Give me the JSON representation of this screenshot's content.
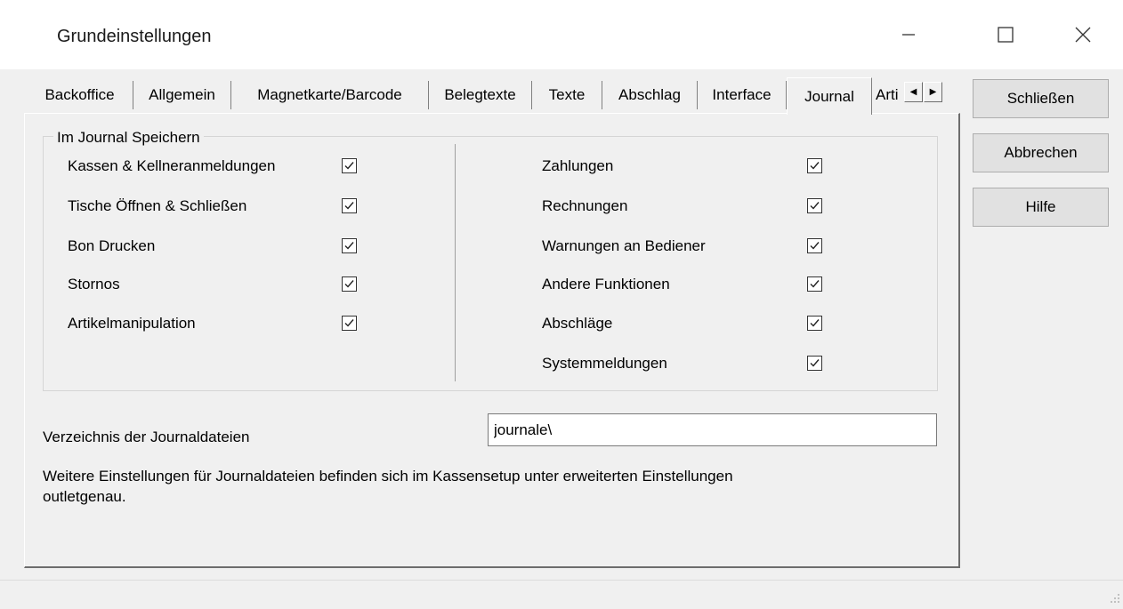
{
  "window": {
    "title": "Grundeinstellungen",
    "minimize_glyph": "—",
    "maximize_glyph": "☐",
    "close_glyph": "✕"
  },
  "tabs": [
    {
      "label": "Backoffice",
      "active": false
    },
    {
      "label": "Allgemein",
      "active": false
    },
    {
      "label": "Magnetkarte/Barcode",
      "active": false
    },
    {
      "label": "Belegtexte",
      "active": false
    },
    {
      "label": "Texte",
      "active": false
    },
    {
      "label": "Abschlag",
      "active": false
    },
    {
      "label": "Interface",
      "active": false
    },
    {
      "label": "Journal",
      "active": true
    },
    {
      "label": "Arti",
      "active": false
    }
  ],
  "tab_scroll": {
    "left_icon": "arrow-left-icon",
    "right_icon": "arrow-right-icon"
  },
  "group": {
    "title": "Im Journal Speichern",
    "left": [
      {
        "label": "Kassen & Kellneranmeldungen",
        "checked": true
      },
      {
        "label": "Tische Öffnen & Schließen",
        "checked": true
      },
      {
        "label": "Bon Drucken",
        "checked": true
      },
      {
        "label": "Stornos",
        "checked": true
      },
      {
        "label": "Artikelmanipulation",
        "checked": true
      }
    ],
    "right": [
      {
        "label": "Zahlungen",
        "checked": true
      },
      {
        "label": "Rechnungen",
        "checked": true
      },
      {
        "label": "Warnungen an Bediener",
        "checked": true
      },
      {
        "label": "Andere Funktionen",
        "checked": true
      },
      {
        "label": "Abschläge",
        "checked": true
      },
      {
        "label": "Systemmeldungen",
        "checked": true
      }
    ]
  },
  "journal_dir": {
    "label": "Verzeichnis der Journaldateien",
    "value": "journale\\"
  },
  "info_text_1": "Weitere Einstellungen für Journaldateien befinden sich im Kassensetup unter erweiterten Einstellungen",
  "info_text_2": "outletgenau.",
  "buttons": {
    "close": "Schließen",
    "cancel": "Abbrechen",
    "help": "Hilfe"
  }
}
